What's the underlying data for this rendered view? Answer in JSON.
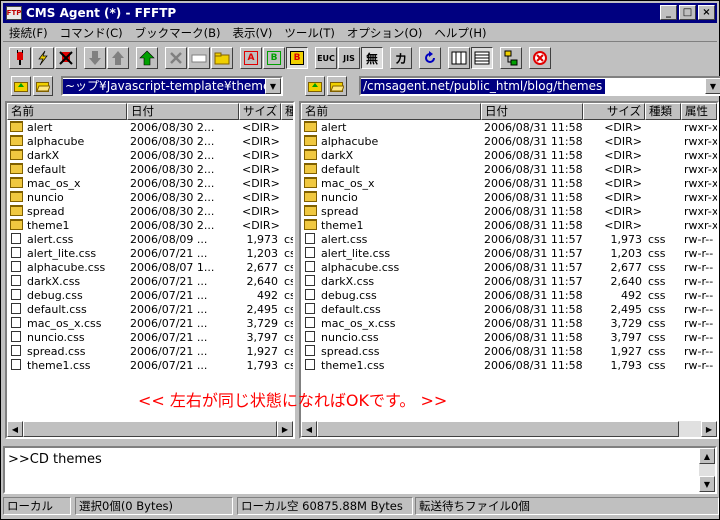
{
  "window": {
    "title": "CMS Agent (*) - FFFTP",
    "app_icon_text": "FTP",
    "min": "_",
    "max": "□",
    "close": "×"
  },
  "menu": [
    "接続(F)",
    "コマンド(C)",
    "ブックマーク(B)",
    "表示(V)",
    "ツール(T)",
    "オプション(O)",
    "ヘルプ(H)"
  ],
  "toolbar": {
    "ascii": "A",
    "binary": "B",
    "auto": "B",
    "euc": "EUC",
    "jis": "JIS",
    "noconv": "無",
    "kana": "カ",
    "colors": {
      "red": "#e00000",
      "green": "#00a000",
      "blue": "#0000c0",
      "yellow": "#f0d000"
    }
  },
  "local": {
    "path": "~ップ¥Javascript-template¥themes"
  },
  "remote": {
    "path": "/cmsagent.net/public_html/blog/themes"
  },
  "headers": {
    "name": "名前",
    "date": "日付",
    "size": "サイズ",
    "type": "種類",
    "type_short": "種",
    "attr": "属性"
  },
  "local_files": [
    {
      "name": "alert",
      "date": "2006/08/30 2...",
      "size": "<DIR>",
      "type": "",
      "kind": "folder"
    },
    {
      "name": "alphacube",
      "date": "2006/08/30 2...",
      "size": "<DIR>",
      "type": "",
      "kind": "folder"
    },
    {
      "name": "darkX",
      "date": "2006/08/30 2...",
      "size": "<DIR>",
      "type": "",
      "kind": "folder"
    },
    {
      "name": "default",
      "date": "2006/08/30 2...",
      "size": "<DIR>",
      "type": "",
      "kind": "folder"
    },
    {
      "name": "mac_os_x",
      "date": "2006/08/30 2...",
      "size": "<DIR>",
      "type": "",
      "kind": "folder"
    },
    {
      "name": "nuncio",
      "date": "2006/08/30 2...",
      "size": "<DIR>",
      "type": "",
      "kind": "folder"
    },
    {
      "name": "spread",
      "date": "2006/08/30 2...",
      "size": "<DIR>",
      "type": "",
      "kind": "folder"
    },
    {
      "name": "theme1",
      "date": "2006/08/30 2...",
      "size": "<DIR>",
      "type": "",
      "kind": "folder"
    },
    {
      "name": "alert.css",
      "date": "2006/08/09 ...",
      "size": "1,973",
      "type": "css",
      "kind": "file"
    },
    {
      "name": "alert_lite.css",
      "date": "2006/07/21 ...",
      "size": "1,203",
      "type": "css",
      "kind": "file"
    },
    {
      "name": "alphacube.css",
      "date": "2006/08/07 1...",
      "size": "2,677",
      "type": "css",
      "kind": "file"
    },
    {
      "name": "darkX.css",
      "date": "2006/07/21 ...",
      "size": "2,640",
      "type": "css",
      "kind": "file"
    },
    {
      "name": "debug.css",
      "date": "2006/07/21 ...",
      "size": "492",
      "type": "css",
      "kind": "file"
    },
    {
      "name": "default.css",
      "date": "2006/07/21 ...",
      "size": "2,495",
      "type": "css",
      "kind": "file"
    },
    {
      "name": "mac_os_x.css",
      "date": "2006/07/21 ...",
      "size": "3,729",
      "type": "css",
      "kind": "file"
    },
    {
      "name": "nuncio.css",
      "date": "2006/07/21 ...",
      "size": "3,797",
      "type": "css",
      "kind": "file"
    },
    {
      "name": "spread.css",
      "date": "2006/07/21 ...",
      "size": "1,927",
      "type": "css",
      "kind": "file"
    },
    {
      "name": "theme1.css",
      "date": "2006/07/21 ...",
      "size": "1,793",
      "type": "css",
      "kind": "file"
    }
  ],
  "remote_files": [
    {
      "name": "alert",
      "date": "2006/08/31 11:58",
      "size": "<DIR>",
      "type": "",
      "attr": "rwxr-x",
      "kind": "folder"
    },
    {
      "name": "alphacube",
      "date": "2006/08/31 11:58",
      "size": "<DIR>",
      "type": "",
      "attr": "rwxr-x",
      "kind": "folder"
    },
    {
      "name": "darkX",
      "date": "2006/08/31 11:58",
      "size": "<DIR>",
      "type": "",
      "attr": "rwxr-x",
      "kind": "folder"
    },
    {
      "name": "default",
      "date": "2006/08/31 11:58",
      "size": "<DIR>",
      "type": "",
      "attr": "rwxr-x",
      "kind": "folder"
    },
    {
      "name": "mac_os_x",
      "date": "2006/08/31 11:58",
      "size": "<DIR>",
      "type": "",
      "attr": "rwxr-x",
      "kind": "folder"
    },
    {
      "name": "nuncio",
      "date": "2006/08/31 11:58",
      "size": "<DIR>",
      "type": "",
      "attr": "rwxr-x",
      "kind": "folder"
    },
    {
      "name": "spread",
      "date": "2006/08/31 11:58",
      "size": "<DIR>",
      "type": "",
      "attr": "rwxr-x",
      "kind": "folder"
    },
    {
      "name": "theme1",
      "date": "2006/08/31 11:58",
      "size": "<DIR>",
      "type": "",
      "attr": "rwxr-x",
      "kind": "folder"
    },
    {
      "name": "alert.css",
      "date": "2006/08/31 11:57",
      "size": "1,973",
      "type": "css",
      "attr": "rw-r--",
      "kind": "file"
    },
    {
      "name": "alert_lite.css",
      "date": "2006/08/31 11:57",
      "size": "1,203",
      "type": "css",
      "attr": "rw-r--",
      "kind": "file"
    },
    {
      "name": "alphacube.css",
      "date": "2006/08/31 11:57",
      "size": "2,677",
      "type": "css",
      "attr": "rw-r--",
      "kind": "file"
    },
    {
      "name": "darkX.css",
      "date": "2006/08/31 11:57",
      "size": "2,640",
      "type": "css",
      "attr": "rw-r--",
      "kind": "file"
    },
    {
      "name": "debug.css",
      "date": "2006/08/31 11:58",
      "size": "492",
      "type": "css",
      "attr": "rw-r--",
      "kind": "file"
    },
    {
      "name": "default.css",
      "date": "2006/08/31 11:58",
      "size": "2,495",
      "type": "css",
      "attr": "rw-r--",
      "kind": "file"
    },
    {
      "name": "mac_os_x.css",
      "date": "2006/08/31 11:58",
      "size": "3,729",
      "type": "css",
      "attr": "rw-r--",
      "kind": "file"
    },
    {
      "name": "nuncio.css",
      "date": "2006/08/31 11:58",
      "size": "3,797",
      "type": "css",
      "attr": "rw-r--",
      "kind": "file"
    },
    {
      "name": "spread.css",
      "date": "2006/08/31 11:58",
      "size": "1,927",
      "type": "css",
      "attr": "rw-r--",
      "kind": "file"
    },
    {
      "name": "theme1.css",
      "date": "2006/08/31 11:58",
      "size": "1,793",
      "type": "css",
      "attr": "rw-r--",
      "kind": "file"
    }
  ],
  "annotation": "<< 左右が同じ状態になればOKです。 >>",
  "log": ">>CD themes",
  "status": {
    "local": "ローカル",
    "selection": "選択0個(0 Bytes)",
    "free": "ローカル空 60875.88M Bytes",
    "queue": "転送待ちファイル0個"
  }
}
